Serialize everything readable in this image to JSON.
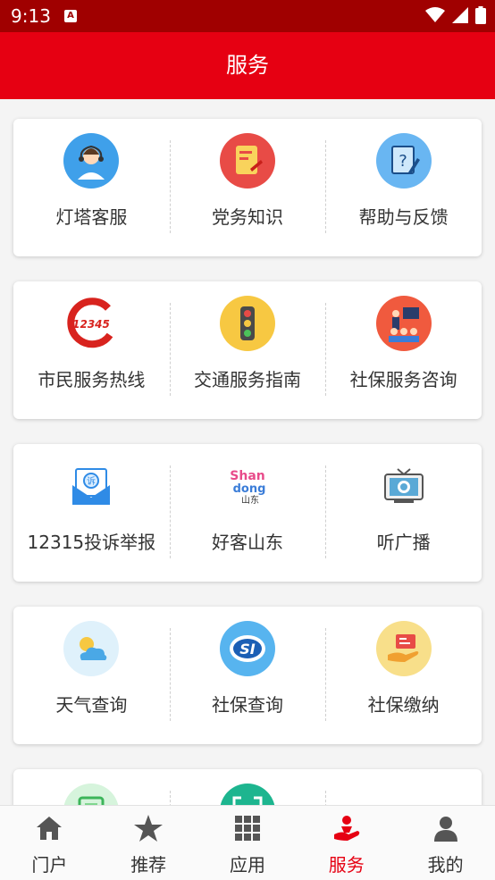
{
  "status_bar": {
    "time": "9:13",
    "notification_badge": "A"
  },
  "app_bar": {
    "title": "服务"
  },
  "cards": [
    {
      "items": [
        {
          "label": "灯塔客服",
          "icon": "customer-service-icon",
          "color": "#3fa0ea"
        },
        {
          "label": "党务知识",
          "icon": "party-knowledge-icon",
          "color": "#e84b46"
        },
        {
          "label": "帮助与反馈",
          "icon": "help-feedback-icon",
          "color": "#69b6f2"
        }
      ]
    },
    {
      "items": [
        {
          "label": "市民服务热线",
          "icon": "hotline-12345-icon",
          "color": "#d8231e",
          "icon_text": "12345"
        },
        {
          "label": "交通服务指南",
          "icon": "traffic-light-icon",
          "color": "#f7c842"
        },
        {
          "label": "社保服务咨询",
          "icon": "consultation-icon",
          "color": "#f05a3e"
        }
      ]
    },
    {
      "items": [
        {
          "label": "12315投诉举报",
          "icon": "complaint-mail-icon",
          "color": "#2f8be6",
          "icon_text": "诉"
        },
        {
          "label": "好客山东",
          "icon": "shandong-logo-icon",
          "color": "#e84b8a",
          "icon_text": "Shan dong 山东"
        },
        {
          "label": "听广播",
          "icon": "radio-tv-icon",
          "color": "#5aa9d6"
        }
      ]
    },
    {
      "items": [
        {
          "label": "天气查询",
          "icon": "weather-icon",
          "color": "#dff1fb"
        },
        {
          "label": "社保查询",
          "icon": "social-security-icon",
          "color": "#57b4ef",
          "icon_text": "SI"
        },
        {
          "label": "社保缴纳",
          "icon": "payment-hand-icon",
          "color": "#f8df8a"
        }
      ]
    },
    {
      "items": [
        {
          "label": "",
          "icon": "scan-green-icon",
          "color": "#7fd68f"
        },
        {
          "label": "",
          "icon": "scan-teal-icon",
          "color": "#1db58f"
        }
      ]
    }
  ],
  "tab_bar": [
    {
      "label": "门户",
      "icon": "home-icon",
      "active": false
    },
    {
      "label": "推荐",
      "icon": "star-icon",
      "active": false
    },
    {
      "label": "应用",
      "icon": "grid-icon",
      "active": false
    },
    {
      "label": "服务",
      "icon": "service-hand-icon",
      "active": true
    },
    {
      "label": "我的",
      "icon": "profile-icon",
      "active": false
    }
  ],
  "colors": {
    "status_bar": "#a00000",
    "app_bar": "#e60012",
    "active_tab": "#e60012"
  }
}
